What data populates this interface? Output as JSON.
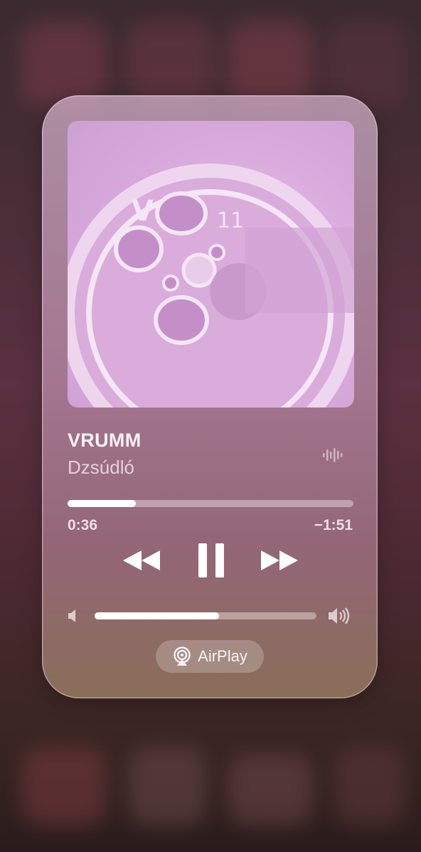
{
  "now_playing": {
    "title": "VRUMM",
    "artist": "Dzsúdló",
    "elapsed": "0:36",
    "remaining": "−1:51",
    "progress_fraction": 0.24,
    "volume_fraction": 0.56
  },
  "airplay": {
    "label": "AirPlay"
  },
  "icons": {
    "rewind": "rewind-icon",
    "pause": "pause-icon",
    "forward": "fast-forward-icon",
    "volume_low": "speaker-low-icon",
    "volume_high": "speaker-high-icon",
    "airplay": "airplay-icon",
    "waveform": "waveform-icon"
  },
  "colors": {
    "panel_tint": "#c898b8",
    "artwork_tint": "#dcaee0",
    "text_primary": "#fbf2fa"
  }
}
